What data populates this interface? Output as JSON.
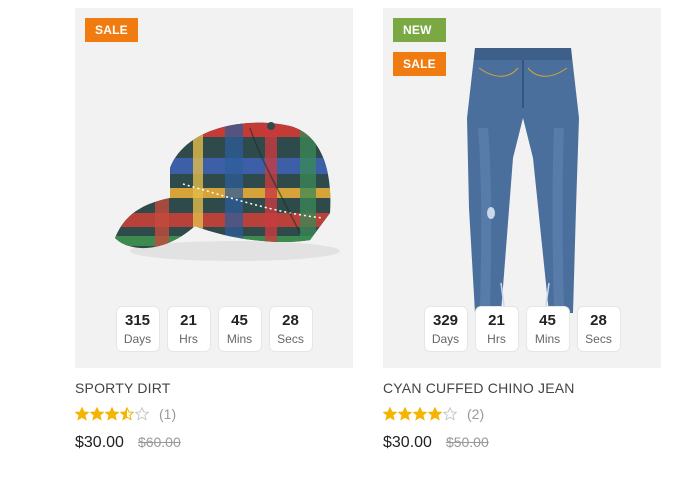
{
  "products": [
    {
      "title": "SPORTY DIRT",
      "badges": [
        {
          "label": "SALE",
          "color": "#f07c11"
        }
      ],
      "countdown": {
        "days": "315",
        "hrs": "21",
        "mins": "45",
        "secs": "28",
        "labels": {
          "days": "Days",
          "hrs": "Hrs",
          "mins": "Mins",
          "secs": "Secs"
        }
      },
      "rating": 3.5,
      "review_count": "(1)",
      "price": "$30.00",
      "old_price": "$60.00",
      "image_icon": "plaid-baseball-cap"
    },
    {
      "title": "CYAN CUFFED CHINO JEAN",
      "badges": [
        {
          "label": "NEW",
          "color": "#7aa843"
        },
        {
          "label": "SALE",
          "color": "#f07c11"
        }
      ],
      "countdown": {
        "days": "329",
        "hrs": "21",
        "mins": "45",
        "secs": "28",
        "labels": {
          "days": "Days",
          "hrs": "Hrs",
          "mins": "Mins",
          "secs": "Secs"
        }
      },
      "rating": 4,
      "review_count": "(2)",
      "price": "$30.00",
      "old_price": "$50.00",
      "image_icon": "blue-skinny-jeans"
    }
  ],
  "colors": {
    "star": "#f5b400",
    "star_empty": "#c8c8c8",
    "sale": "#f07c11",
    "new": "#7aa843"
  }
}
